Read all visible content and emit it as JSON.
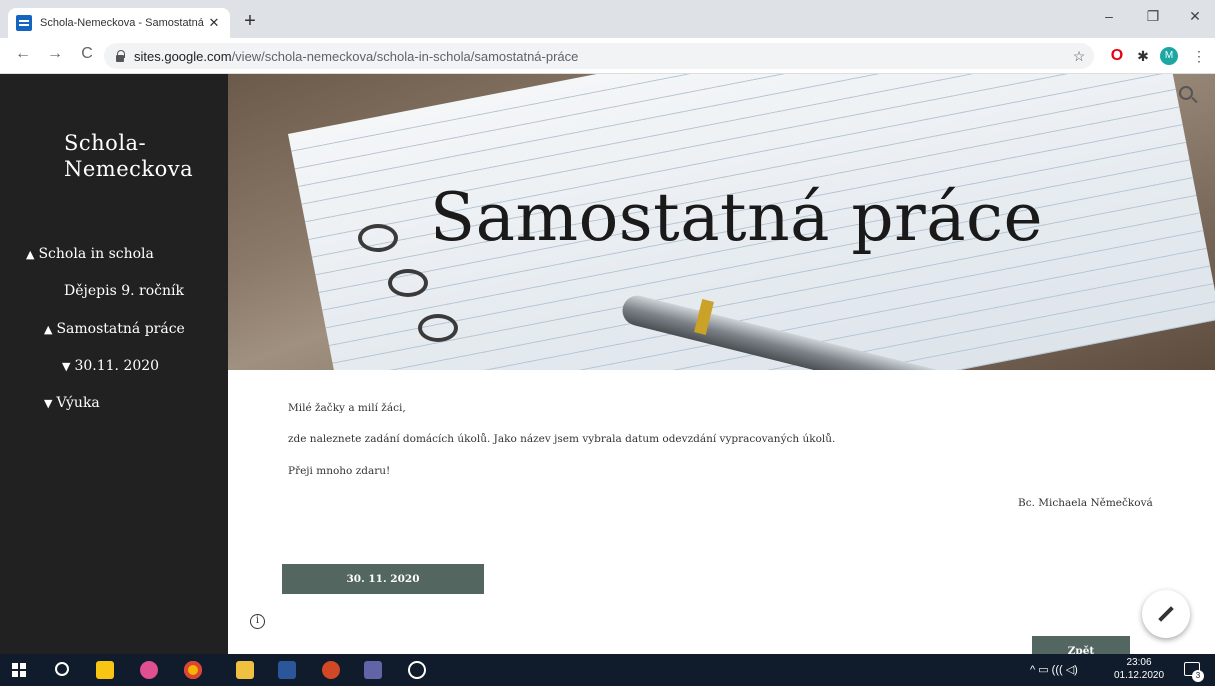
{
  "browser": {
    "tab_title": "Schola-Nemeckova - Samostatná p",
    "tab_close": "✕",
    "new_tab": "+",
    "url_host": "sites.google.com",
    "url_path": "/view/schola-nemeckova/schola-in-schola/samostatná-práce",
    "window_controls": {
      "minimize": "–",
      "maximize": "❐",
      "close": "✕"
    },
    "nav": {
      "back": "←",
      "forward": "→",
      "reload": "C"
    },
    "extensions": {
      "star": "☆",
      "opera": "O",
      "puzzle": "✱",
      "avatar": "M",
      "menu": "⋮"
    }
  },
  "sidebar": {
    "site_title": "Schola-Nemeckova",
    "items": [
      {
        "label": "Schola in schola",
        "chevron": "up"
      },
      {
        "label": "Dějepis 9. ročník",
        "chevron": "none"
      },
      {
        "label": "Samostatná práce",
        "chevron": "up"
      },
      {
        "label": "30.11. 2020",
        "chevron": "down"
      },
      {
        "label": "Výuka",
        "chevron": "down"
      }
    ]
  },
  "hero": {
    "title": "Samostatná práce"
  },
  "content": {
    "greeting": "Milé žačky a milí žáci,",
    "body": "zde naleznete zadání domácích úkolů. Jako název jsem vybrala datum odevzdání vypracovaných úkolů.",
    "wish": "Přeji mnoho zdaru!",
    "signature": "Bc. Michaela Němečková",
    "date_button": "30. 11. 2020",
    "back_button": "Zpět",
    "info_glyph": "i"
  },
  "taskbar": {
    "time": "23:06",
    "date": "01.12.2020",
    "notification_count": "3"
  },
  "colors": {
    "sidebar_bg": "#212121",
    "button_bg": "#53665f",
    "taskbar_bg": "#101b2b"
  }
}
